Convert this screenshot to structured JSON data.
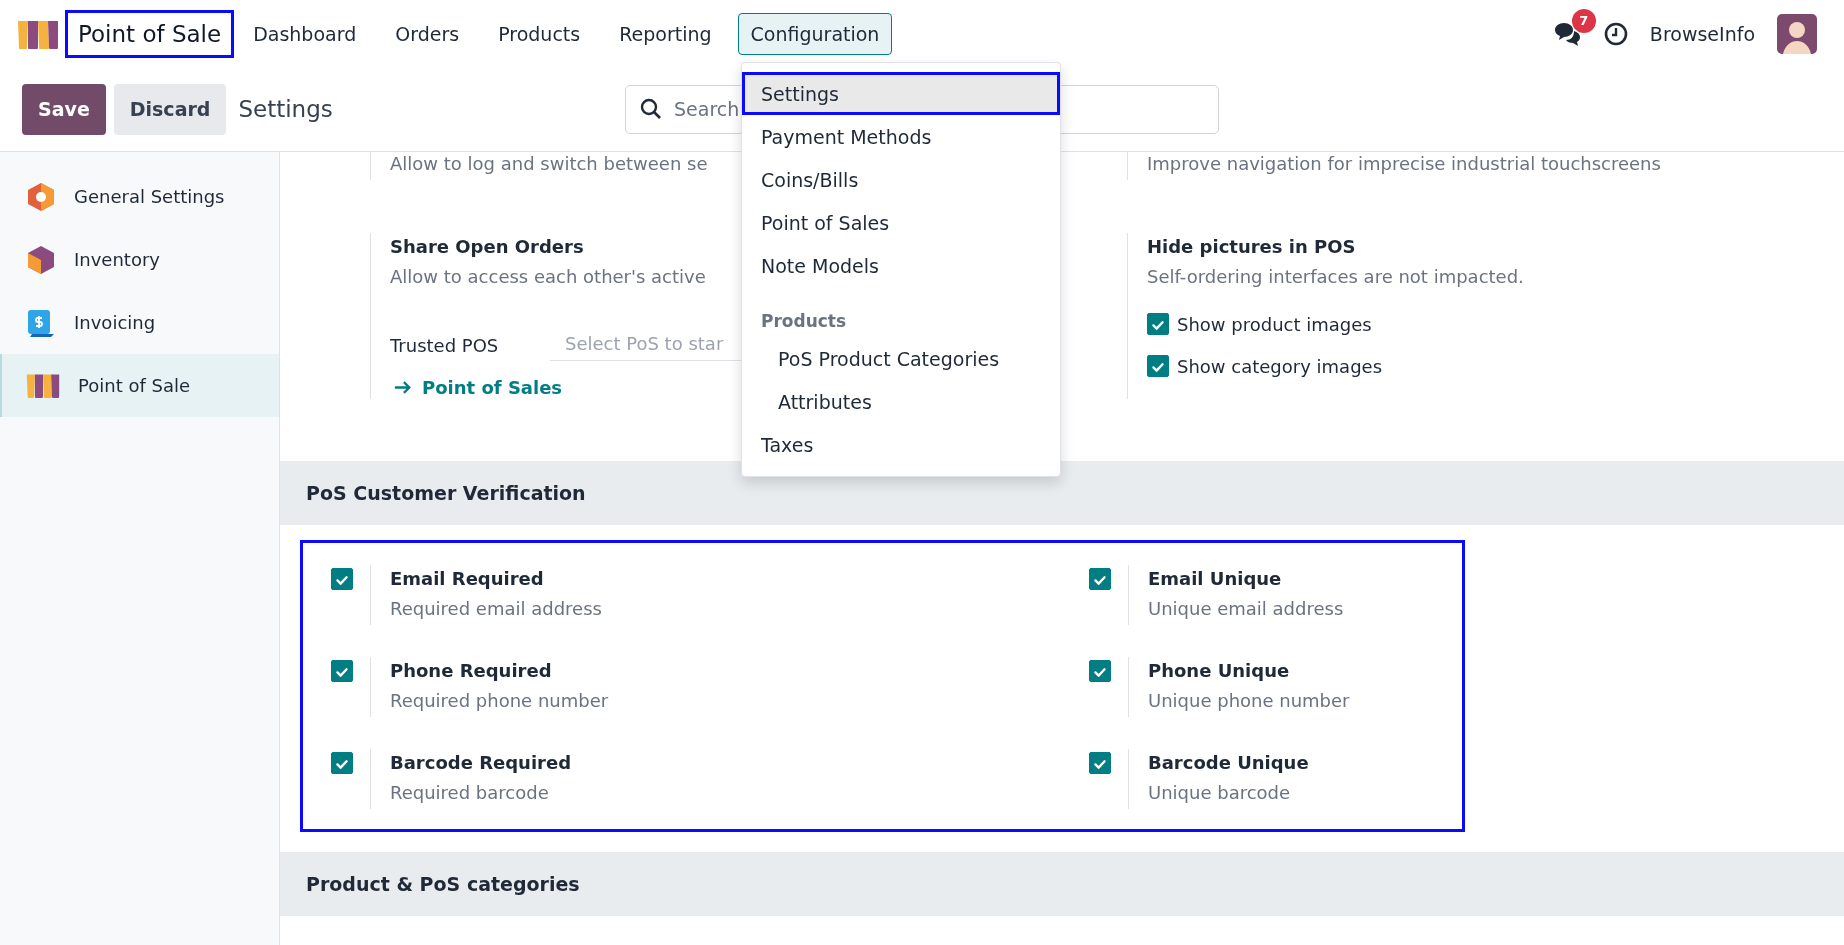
{
  "navbar": {
    "app_name": "Point of Sale",
    "app_name_highlighted": true,
    "menu": [
      {
        "label": "Dashboard",
        "selected": false
      },
      {
        "label": "Orders",
        "selected": false
      },
      {
        "label": "Products",
        "selected": false
      },
      {
        "label": "Reporting",
        "selected": false
      },
      {
        "label": "Configuration",
        "selected": true
      }
    ],
    "messages_badge": "7",
    "user_name": "BrowseInfo"
  },
  "control_panel": {
    "buttons": [
      {
        "label": "Save",
        "kind": "primary"
      },
      {
        "label": "Discard",
        "kind": "secondary"
      }
    ],
    "title": "Settings",
    "search": {
      "placeholder": "Search"
    }
  },
  "sidebar": {
    "items": [
      {
        "label": "General Settings",
        "selected": false
      },
      {
        "label": "Inventory",
        "selected": false
      },
      {
        "label": "Invoicing",
        "selected": false
      },
      {
        "label": "Point of Sale",
        "selected": true
      }
    ]
  },
  "settings_rows": [
    {
      "left": {
        "description": "Allow to log and switch between se"
      },
      "right": {
        "description": "Improve navigation for imprecise industrial touchscreens"
      }
    },
    {
      "left": {
        "title": "Share Open Orders",
        "description": "Allow to access each other's active",
        "field_label": "Trusted POS",
        "field_placeholder": "Select PoS to star",
        "link": "Point of Sales"
      },
      "right": {
        "title": "Hide pictures in POS",
        "description": "Self-ordering interfaces are not impacted.",
        "options": [
          {
            "label": "Show product images",
            "checked": true
          },
          {
            "label": "Show category images",
            "checked": true
          }
        ]
      }
    }
  ],
  "sections": [
    {
      "title": "PoS Customer Verification",
      "highlighted": true,
      "settings": [
        {
          "title": "Email Required",
          "description": "Required email address",
          "checked": true
        },
        {
          "title": "Email Unique",
          "description": "Unique email address",
          "checked": true
        },
        {
          "title": "Phone Required",
          "description": "Required phone number",
          "checked": true
        },
        {
          "title": "Phone Unique",
          "description": "Unique phone number",
          "checked": true
        },
        {
          "title": "Barcode Required",
          "description": "Required barcode",
          "checked": true
        },
        {
          "title": "Barcode Unique",
          "description": "Unique barcode",
          "checked": true
        }
      ]
    },
    {
      "title": "Product & PoS categories"
    }
  ],
  "dropdown": {
    "items": [
      {
        "kind": "item",
        "label": "Settings",
        "selected": true
      },
      {
        "kind": "item",
        "label": "Payment Methods",
        "selected": false
      },
      {
        "kind": "item",
        "label": "Coins/Bills",
        "selected": false
      },
      {
        "kind": "item",
        "label": "Point of Sales",
        "selected": false
      },
      {
        "kind": "item",
        "label": "Note Models",
        "selected": false
      },
      {
        "kind": "group",
        "label": "Products",
        "children": [
          {
            "kind": "item",
            "label": "PoS Product Categories",
            "selected": false
          },
          {
            "kind": "item",
            "label": "Attributes",
            "selected": false
          }
        ]
      },
      {
        "kind": "item",
        "label": "Taxes",
        "selected": false
      }
    ]
  }
}
